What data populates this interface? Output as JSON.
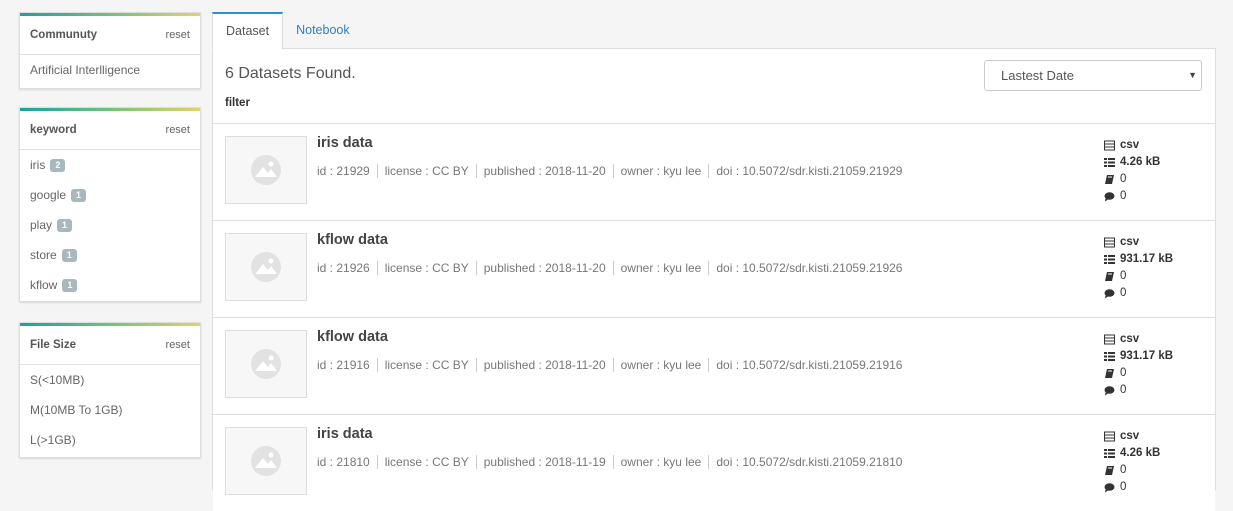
{
  "sidebar": {
    "community": {
      "title": "Communuty",
      "reset": "reset",
      "items": [
        "Artificial Interlligence"
      ]
    },
    "keyword": {
      "title": "keyword",
      "reset": "reset",
      "items": [
        {
          "label": "iris",
          "count": "2"
        },
        {
          "label": "google",
          "count": "1"
        },
        {
          "label": "play",
          "count": "1"
        },
        {
          "label": "store",
          "count": "1"
        },
        {
          "label": "kflow",
          "count": "1"
        }
      ]
    },
    "filesize": {
      "title": "File Size",
      "reset": "reset",
      "items": [
        "S(<10MB)",
        "M(10MB To 1GB)",
        "L(>1GB)"
      ]
    }
  },
  "tabs": [
    {
      "label": "Dataset",
      "active": true
    },
    {
      "label": "Notebook",
      "active": false
    }
  ],
  "main": {
    "found_text": "6 Datasets Found.",
    "filter_label": "filter",
    "sort_value": "Lastest Date"
  },
  "datasets": [
    {
      "title": "iris data",
      "id": "id : 21929",
      "license": "license : CC BY",
      "published": "published : 2018-11-20",
      "owner": "owner : kyu lee",
      "doi": "doi : 10.5072/sdr.kisti.21059.21929",
      "format": "csv",
      "size": "4.26 kB",
      "notebooks": "0",
      "comments": "0"
    },
    {
      "title": "kflow data",
      "id": "id : 21926",
      "license": "license : CC BY",
      "published": "published : 2018-11-20",
      "owner": "owner : kyu lee",
      "doi": "doi : 10.5072/sdr.kisti.21059.21926",
      "format": "csv",
      "size": "931.17 kB",
      "notebooks": "0",
      "comments": "0"
    },
    {
      "title": "kflow data",
      "id": "id : 21916",
      "license": "license : CC BY",
      "published": "published : 2018-11-20",
      "owner": "owner : kyu lee",
      "doi": "doi : 10.5072/sdr.kisti.21059.21916",
      "format": "csv",
      "size": "931.17 kB",
      "notebooks": "0",
      "comments": "0"
    },
    {
      "title": "iris data",
      "id": "id : 21810",
      "license": "license : CC BY",
      "published": "published : 2018-11-19",
      "owner": "owner : kyu lee",
      "doi": "doi : 10.5072/sdr.kisti.21059.21810",
      "format": "csv",
      "size": "4.26 kB",
      "notebooks": "0",
      "comments": "0"
    }
  ],
  "icons": {
    "format": "table-icon",
    "size": "list-icon",
    "notebooks": "book-icon",
    "comments": "comment-icon",
    "thumbnail": "image-placeholder-icon"
  },
  "colors": {
    "accent": "#2f8fc9",
    "badge": "#a9b8bf",
    "panel_gradient": [
      "#17a2a2",
      "#7cc576",
      "#e0d46a"
    ]
  }
}
